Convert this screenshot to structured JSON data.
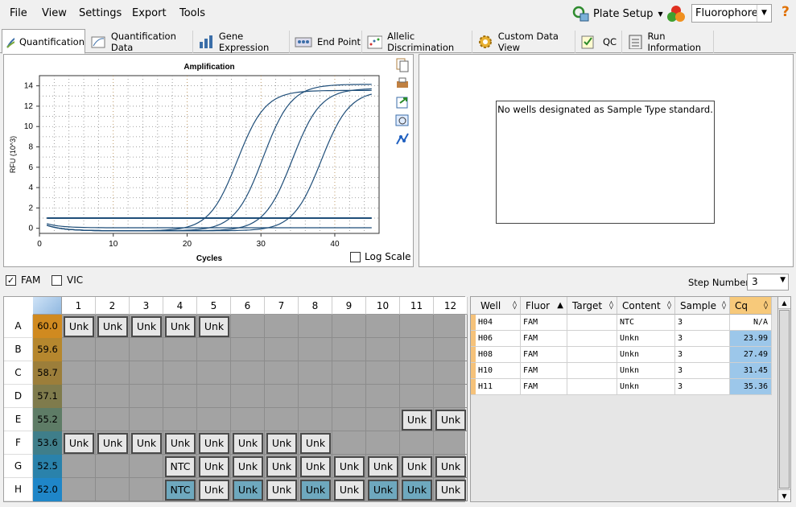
{
  "menu": [
    "File",
    "View",
    "Settings",
    "Export",
    "Tools"
  ],
  "toolbar": {
    "plate_setup": "Plate Setup",
    "fluorophore": "Fluorophore",
    "help": "?"
  },
  "tabs": [
    "Quantification",
    "Quantification Data",
    "Gene Expression",
    "End Point",
    "Allelic Discrimination",
    "Custom Data View",
    "QC",
    "Run Information"
  ],
  "chart_panel": {
    "log_scale_label": "Log Scale"
  },
  "std_panel": {
    "message": "No wells designated as Sample Type standard."
  },
  "filters": {
    "fam": "FAM",
    "vic": "VIC",
    "step_label": "Step Number:",
    "step_value": "3"
  },
  "plate": {
    "cols": [
      "1",
      "2",
      "3",
      "4",
      "5",
      "6",
      "7",
      "8",
      "9",
      "10",
      "11",
      "12"
    ],
    "rows": [
      "A",
      "B",
      "C",
      "D",
      "E",
      "F",
      "G",
      "H"
    ],
    "temps": [
      "60.0",
      "59.6",
      "58.7",
      "57.1",
      "55.2",
      "53.6",
      "52.5",
      "52.0"
    ],
    "wells": [
      [
        "Unk",
        "Unk",
        "Unk",
        "Unk",
        "Unk",
        "",
        "",
        "",
        "",
        "",
        "",
        ""
      ],
      [
        "",
        "",
        "",
        "",
        "",
        "",
        "",
        "",
        "",
        "",
        "",
        ""
      ],
      [
        "",
        "",
        "",
        "",
        "",
        "",
        "",
        "",
        "",
        "",
        "",
        ""
      ],
      [
        "",
        "",
        "",
        "",
        "",
        "",
        "",
        "",
        "",
        "",
        "",
        ""
      ],
      [
        "",
        "",
        "",
        "",
        "",
        "",
        "",
        "",
        "",
        "",
        "Unk",
        "Unk"
      ],
      [
        "Unk",
        "Unk",
        "Unk",
        "Unk",
        "Unk",
        "Unk",
        "Unk",
        "Unk",
        "",
        "",
        "",
        ""
      ],
      [
        "",
        "",
        "",
        "NTC",
        "Unk",
        "Unk",
        "Unk",
        "Unk",
        "Unk",
        "Unk",
        "Unk",
        "Unk"
      ],
      [
        "",
        "",
        "",
        "NTC",
        "Unk",
        "Unk",
        "Unk",
        "Unk",
        "Unk",
        "Unk",
        "Unk",
        "Unk"
      ]
    ],
    "selected": [
      "H4",
      "H6",
      "H8",
      "H10",
      "H11"
    ]
  },
  "table": {
    "headers": [
      "Well",
      "Fluor",
      "Target",
      "Content",
      "Sample",
      "Cq"
    ],
    "rows": [
      [
        "H04",
        "FAM",
        "",
        "NTC",
        "3",
        "N/A"
      ],
      [
        "H06",
        "FAM",
        "",
        "Unkn",
        "3",
        "23.99"
      ],
      [
        "H08",
        "FAM",
        "",
        "Unkn",
        "3",
        "27.49"
      ],
      [
        "H10",
        "FAM",
        "",
        "Unkn",
        "3",
        "31.45"
      ],
      [
        "H11",
        "FAM",
        "",
        "Unkn",
        "3",
        "35.36"
      ]
    ]
  },
  "chart_data": {
    "type": "line",
    "title": "Amplification",
    "xlabel": "Cycles",
    "ylabel": "RFU (10^3)",
    "xlim": [
      0,
      46
    ],
    "ylim": [
      -0.5,
      15
    ],
    "xticks": [
      0,
      10,
      20,
      30,
      40
    ],
    "yticks": [
      0,
      2,
      4,
      6,
      8,
      10,
      12,
      14
    ],
    "threshold": 1.0,
    "color": "#1f4e79",
    "series": [
      {
        "cq": 23.99,
        "plateau": 13.8
      },
      {
        "cq": 27.49,
        "plateau": 14.4
      },
      {
        "cq": 31.45,
        "plateau": 14.0
      },
      {
        "cq": 35.36,
        "plateau": 13.8
      },
      {
        "cq": null,
        "plateau": 0
      }
    ]
  }
}
